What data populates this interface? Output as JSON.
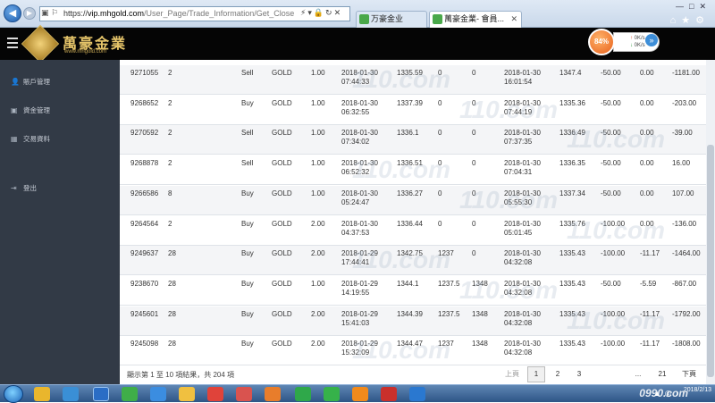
{
  "browser": {
    "url_scheme": "https://",
    "url_host": "vip.mhgold.com",
    "url_path": "/User_Page/Trade_Information/Get_Close",
    "tabs": [
      {
        "label": "万豪金业"
      },
      {
        "label": "萬豪金業- 會員..."
      }
    ]
  },
  "header": {
    "logo_text": "萬豪金業",
    "logo_sub": "www.mhgold.com",
    "speed_percent": "84%",
    "up_rate": "0K/s",
    "down_rate": "0K/s"
  },
  "sidebar": {
    "items": [
      {
        "label": "賬戶管理",
        "icon": "user-icon"
      },
      {
        "label": "資金管理",
        "icon": "money-icon"
      },
      {
        "label": "交易資料",
        "icon": "chart-icon"
      },
      {
        "label": "登出",
        "icon": "logout-icon"
      }
    ]
  },
  "table": {
    "rows": [
      {
        "order": "9271055",
        "acct": "2",
        "type": "Sell",
        "symbol": "GOLD",
        "lots": "1.00",
        "open_date": "2018-01-30",
        "open_time": "07:44:33",
        "open_price": "1335.59",
        "sl": "0",
        "tp": "0",
        "close_date": "2018-01-30",
        "close_time": "16:01:54",
        "close_price": "1347.4",
        "commission": "-50.00",
        "swap": "0.00",
        "profit": "-1181.00"
      },
      {
        "order": "9268652",
        "acct": "2",
        "type": "Buy",
        "symbol": "GOLD",
        "lots": "1.00",
        "open_date": "2018-01-30",
        "open_time": "06:32:55",
        "open_price": "1337.39",
        "sl": "0",
        "tp": "0",
        "close_date": "2018-01-30",
        "close_time": "07:44:19",
        "close_price": "1335.36",
        "commission": "-50.00",
        "swap": "0.00",
        "profit": "-203.00"
      },
      {
        "order": "9270592",
        "acct": "2",
        "type": "Sell",
        "symbol": "GOLD",
        "lots": "1.00",
        "open_date": "2018-01-30",
        "open_time": "07:34:02",
        "open_price": "1336.1",
        "sl": "0",
        "tp": "0",
        "close_date": "2018-01-30",
        "close_time": "07:37:35",
        "close_price": "1336.49",
        "commission": "-50.00",
        "swap": "0.00",
        "profit": "-39.00"
      },
      {
        "order": "9268878",
        "acct": "2",
        "type": "Sell",
        "symbol": "GOLD",
        "lots": "1.00",
        "open_date": "2018-01-30",
        "open_time": "06:52:32",
        "open_price": "1336.51",
        "sl": "0",
        "tp": "0",
        "close_date": "2018-01-30",
        "close_time": "07:04:31",
        "close_price": "1336.35",
        "commission": "-50.00",
        "swap": "0.00",
        "profit": "16.00"
      },
      {
        "order": "9266586",
        "acct": "8",
        "type": "Buy",
        "symbol": "GOLD",
        "lots": "1.00",
        "open_date": "2018-01-30",
        "open_time": "05:24:47",
        "open_price": "1336.27",
        "sl": "0",
        "tp": "0",
        "close_date": "2018-01-30",
        "close_time": "05:55:30",
        "close_price": "1337.34",
        "commission": "-50.00",
        "swap": "0.00",
        "profit": "107.00"
      },
      {
        "order": "9264564",
        "acct": "2",
        "type": "Buy",
        "symbol": "GOLD",
        "lots": "2.00",
        "open_date": "2018-01-30",
        "open_time": "04:37:53",
        "open_price": "1336.44",
        "sl": "0",
        "tp": "0",
        "close_date": "2018-01-30",
        "close_time": "05:01:45",
        "close_price": "1335.76",
        "commission": "-100.00",
        "swap": "0.00",
        "profit": "-136.00"
      },
      {
        "order": "9249637",
        "acct": "28",
        "type": "Buy",
        "symbol": "GOLD",
        "lots": "2.00",
        "open_date": "2018-01-29",
        "open_time": "17:44:41",
        "open_price": "1342.75",
        "sl": "1237",
        "tp": "0",
        "close_date": "2018-01-30",
        "close_time": "04:32:08",
        "close_price": "1335.43",
        "commission": "-100.00",
        "swap": "-11.17",
        "profit": "-1464.00"
      },
      {
        "order": "9238670",
        "acct": "28",
        "type": "Buy",
        "symbol": "GOLD",
        "lots": "1.00",
        "open_date": "2018-01-29",
        "open_time": "14:19:55",
        "open_price": "1344.1",
        "sl": "1237.5",
        "tp": "1348",
        "close_date": "2018-01-30",
        "close_time": "04:32:08",
        "close_price": "1335.43",
        "commission": "-50.00",
        "swap": "-5.59",
        "profit": "-867.00"
      },
      {
        "order": "9245601",
        "acct": "28",
        "type": "Buy",
        "symbol": "GOLD",
        "lots": "2.00",
        "open_date": "2018-01-29",
        "open_time": "15:41:03",
        "open_price": "1344.39",
        "sl": "1237.5",
        "tp": "1348",
        "close_date": "2018-01-30",
        "close_time": "04:32:08",
        "close_price": "1335.43",
        "commission": "-100.00",
        "swap": "-11.17",
        "profit": "-1792.00"
      },
      {
        "order": "9245098",
        "acct": "28",
        "type": "Buy",
        "symbol": "GOLD",
        "lots": "2.00",
        "open_date": "2018-01-29",
        "open_time": "15:32:09",
        "open_price": "1344.47",
        "sl": "1237",
        "tp": "1348",
        "close_date": "2018-01-30",
        "close_time": "04:32:08",
        "close_price": "1335.43",
        "commission": "-100.00",
        "swap": "-11.17",
        "profit": "-1808.00"
      }
    ]
  },
  "footer": {
    "info": "顯示第 1 至 10 項結果，共 204 項",
    "prev": "上頁",
    "pages": [
      "1",
      "2",
      "3"
    ],
    "ellipsis": "...",
    "last": "21",
    "next": "下頁"
  },
  "watermark": "110.com",
  "taskbar": {
    "clock_time": "",
    "clock_date": "2018/2/13",
    "brand": "0990.com"
  }
}
